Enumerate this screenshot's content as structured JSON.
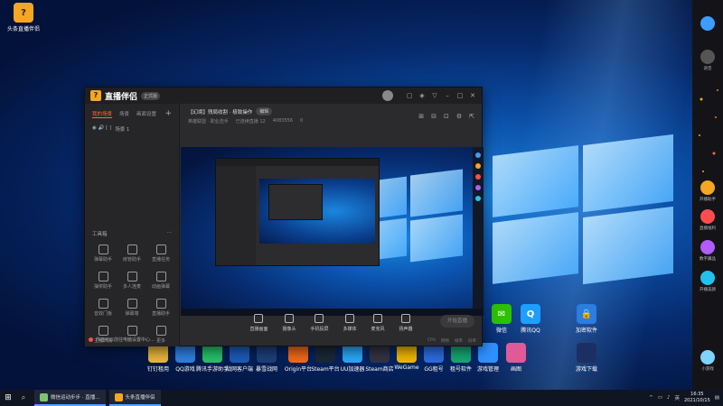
{
  "desktop": {
    "top_icon": {
      "label": "头条直播伴侣"
    },
    "icons_row": [
      {
        "label": "钉钉租用",
        "color": "#e8b63b"
      },
      {
        "label": "QQ游戏",
        "color": "#2f7fe0"
      },
      {
        "label": "腾讯手游助手",
        "color": "#28c16a"
      },
      {
        "label": "战网客户端",
        "color": "#1b5cb8"
      },
      {
        "label": "暴雪战网",
        "color": "#1e3f7a"
      },
      {
        "label": "Origin平台",
        "color": "#f06a1a"
      },
      {
        "label": "Steam平台",
        "color": "#1b2838"
      },
      {
        "label": "UU加速器",
        "color": "#2ba6f7"
      },
      {
        "label": "Steam商店",
        "color": "#334"
      },
      {
        "label": "WeGame",
        "color": "#f2b705"
      },
      {
        "label": "GG租号",
        "color": "#2d6cdf"
      },
      {
        "label": "租号软件",
        "color": "#17a673"
      },
      {
        "label": "游戏管理",
        "color": "#2f91ff"
      },
      {
        "label": "画图",
        "color": "#e05a9a"
      },
      {
        "label": "游戏下载",
        "color": "#1c2f63"
      }
    ],
    "icons_upper": [
      {
        "label": "微信",
        "color": "#2dc100",
        "glyph": "✉"
      },
      {
        "label": "腾讯QQ",
        "color": "#1e9fff",
        "glyph": "Q"
      },
      {
        "label": "加密软件",
        "color": "#2a7de1",
        "glyph": "🔒"
      }
    ]
  },
  "app": {
    "logo_icon": "app-logo-icon",
    "name": "直播伴侣",
    "version": "正式版",
    "left_tabs": [
      "我的场景",
      "场景",
      "画面设置"
    ],
    "scene_label": "场景 1",
    "scene_prefix": "◉ 🔊 [ ]",
    "toolbox_title": "工具箱",
    "tools": [
      "弹幕助手",
      "房管助手",
      "直播任务",
      "抽奖助手",
      "多人连麦",
      "动画弹幕",
      "音效门板",
      "弹幕墙",
      "直播助手",
      "主播商城",
      "",
      "更多"
    ],
    "bottom_tip": "你还可以前往电脑设置中心...",
    "live_title": "【幻境】残局收割 · 极致操作",
    "edit_label": "编辑",
    "live_meta": [
      "英雄联盟 · 职业选手",
      "已连续直播 12",
      "4083556",
      "0"
    ],
    "bottom_buttons": [
      "直播画面",
      "摄像头",
      "手机投屏",
      "多媒体",
      "麦克风",
      "扬声器"
    ],
    "go_live_label": "开始直播",
    "status_items": [
      "CPU",
      "网络",
      "帧率",
      "码率"
    ]
  },
  "sidebar": {
    "items": [
      {
        "label": "",
        "color": "#3c9cff"
      },
      {
        "label": "语音",
        "color": "#555"
      },
      {
        "label": "开播助手",
        "color": "#f5a623"
      },
      {
        "label": "直播福利",
        "color": "#ff4d4f"
      },
      {
        "label": "数字藏品",
        "color": "#b05cff"
      },
      {
        "label": "开播美颜",
        "color": "#22c1ee"
      },
      {
        "label": "小游戏",
        "color": "#7fd4ff"
      }
    ]
  },
  "taskbar": {
    "tasks": [
      "微信运动步步 · 直播...",
      "头条直播伴侣"
    ],
    "tray_lang": "英",
    "time": "16:35",
    "date": "2021/10/15"
  }
}
